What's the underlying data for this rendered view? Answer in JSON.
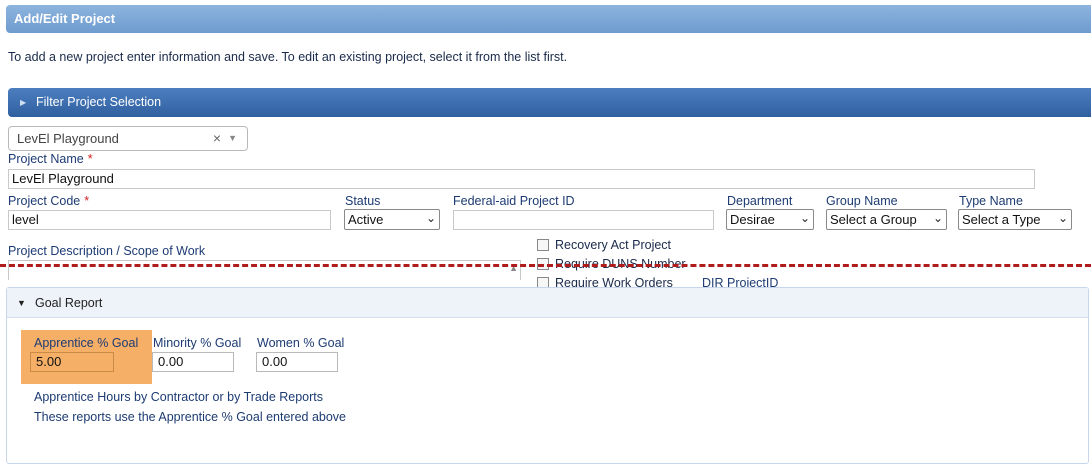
{
  "header": {
    "title": "Add/Edit Project",
    "intro": "To add a new project enter information and save. To edit an existing project, select it from the list first."
  },
  "filter": {
    "label": "Filter Project Selection",
    "selected_project": "LevEl Playground",
    "clear_symbol": "×",
    "caret_symbol": "▼"
  },
  "form": {
    "project_name": {
      "label": "Project Name",
      "required_mark": "*",
      "value": "LevEl Playground"
    },
    "project_code": {
      "label": "Project Code",
      "required_mark": "*",
      "value": "level"
    },
    "status": {
      "label": "Status",
      "value": "Active"
    },
    "federal_aid_id": {
      "label": "Federal-aid Project ID",
      "value": ""
    },
    "department": {
      "label": "Department",
      "value": "Desirae"
    },
    "group_name": {
      "label": "Group Name",
      "value": "Select a Group"
    },
    "type_name": {
      "label": "Type Name",
      "value": "Select a Type"
    },
    "description": {
      "label": "Project Description / Scope of Work",
      "value": ""
    },
    "checkboxes": [
      {
        "label": "Recovery Act Project",
        "checked": false
      },
      {
        "label": "Require DUNS Number",
        "checked": false
      },
      {
        "label": "Require Work Orders",
        "checked": false
      }
    ],
    "dir_project_id_label": "DIR ProjectID"
  },
  "goal_report": {
    "title": "Goal Report",
    "apprentice": {
      "label": "Apprentice % Goal",
      "value": "5.00"
    },
    "minority": {
      "label": "Minority % Goal",
      "value": "0.00"
    },
    "women": {
      "label": "Women % Goal",
      "value": "0.00"
    },
    "note_line1": "Apprentice Hours by Contractor or by Trade Reports",
    "note_line2": "These reports use the Apprentice % Goal entered above"
  },
  "colors": {
    "title_bar": "#7ea8d8",
    "filter_bar": "#3c6cad",
    "label_text": "#1d3b73",
    "required_star": "#d02020",
    "cut_line": "#b01c1c",
    "highlight": "#f5a85a"
  }
}
